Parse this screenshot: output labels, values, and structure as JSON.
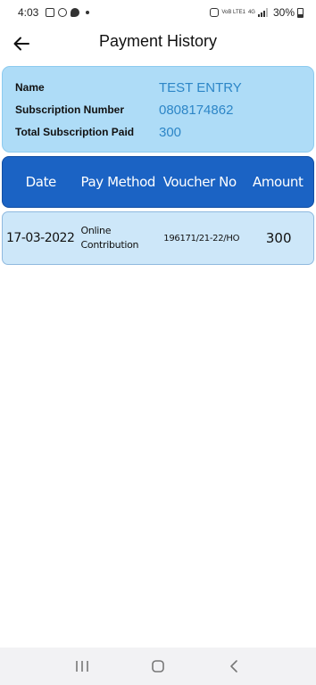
{
  "status_bar": {
    "time": "4:03",
    "network_volte": "VoB LTE1",
    "network_4g": "4G",
    "battery": "30%"
  },
  "app_bar": {
    "title": "Payment History"
  },
  "summary": {
    "name_label": "Name",
    "name_value": "TEST ENTRY",
    "subscription_number_label": "Subscription Number",
    "subscription_number_value": "0808174862",
    "total_paid_label": "Total Subscription Paid",
    "total_paid_value": "300"
  },
  "table": {
    "headers": {
      "date": "Date",
      "pay_method": "Pay Method",
      "voucher_no": "Voucher No",
      "amount": "Amount"
    },
    "rows": [
      {
        "date": "17-03-2022",
        "pay_method_line1": "Online",
        "pay_method_line2": "Contribution",
        "voucher_no": "196171/21-22/HO",
        "amount": "300"
      }
    ]
  },
  "colors": {
    "summary_bg": "#aedcf7",
    "summary_value": "#2d86c7",
    "header_bg": "#1b63c4",
    "row_bg": "#cde7f9"
  },
  "icons": [
    "back-arrow-icon",
    "recent-apps-icon",
    "home-icon",
    "nav-back-icon"
  ]
}
